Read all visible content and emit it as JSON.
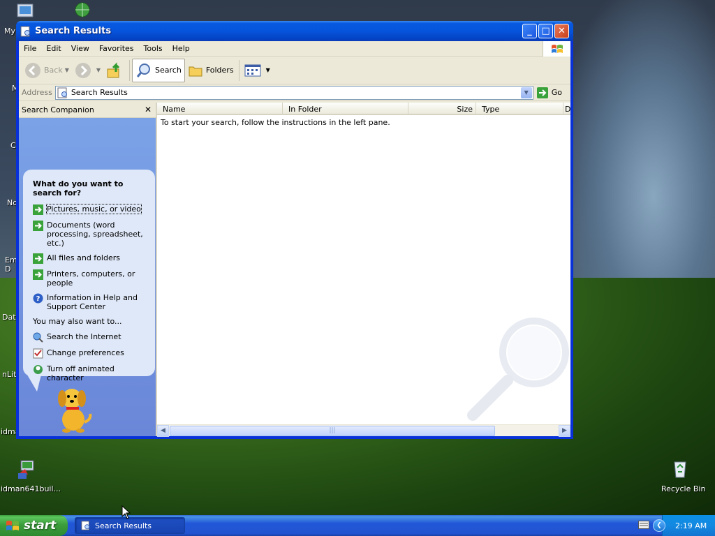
{
  "desktop": {
    "icons": [
      {
        "label": "My"
      },
      {
        "label": "M"
      },
      {
        "label": "C"
      },
      {
        "label": "No"
      },
      {
        "label": "Em D"
      },
      {
        "label": "Data"
      },
      {
        "label": "nLite"
      },
      {
        "label": "idma"
      },
      {
        "label": "idman641buil..."
      },
      {
        "label": "Recycle Bin"
      }
    ]
  },
  "window": {
    "title": "Search Results",
    "menu": [
      "File",
      "Edit",
      "View",
      "Favorites",
      "Tools",
      "Help"
    ],
    "toolbar": {
      "back": "Back",
      "search": "Search",
      "folders": "Folders"
    },
    "address": {
      "label": "Address",
      "value": "Search Results",
      "go": "Go"
    },
    "companion": {
      "header": "Search Companion",
      "question": "What do you want to search for?",
      "options": [
        {
          "label": "Pictures, music, or video",
          "icon": "arrow-icon"
        },
        {
          "label": "Documents (word processing, spreadsheet, etc.)",
          "icon": "arrow-icon"
        },
        {
          "label": "All files and folders",
          "icon": "arrow-icon"
        },
        {
          "label": "Printers, computers, or people",
          "icon": "arrow-icon"
        },
        {
          "label": "Information in Help and Support Center",
          "icon": "help-icon"
        }
      ],
      "also_label": "You may also want to...",
      "also": [
        {
          "label": "Search the Internet",
          "icon": "globe-search-icon"
        },
        {
          "label": "Change preferences",
          "icon": "preferences-icon"
        },
        {
          "label": "Turn off animated character",
          "icon": "character-icon"
        }
      ]
    },
    "columns": [
      "Name",
      "In Folder",
      "Size",
      "Type",
      "D"
    ],
    "instructions": "To start your search, follow the instructions in the left pane."
  },
  "taskbar": {
    "start": "start",
    "task": "Search Results",
    "clock": "2:19 AM"
  }
}
